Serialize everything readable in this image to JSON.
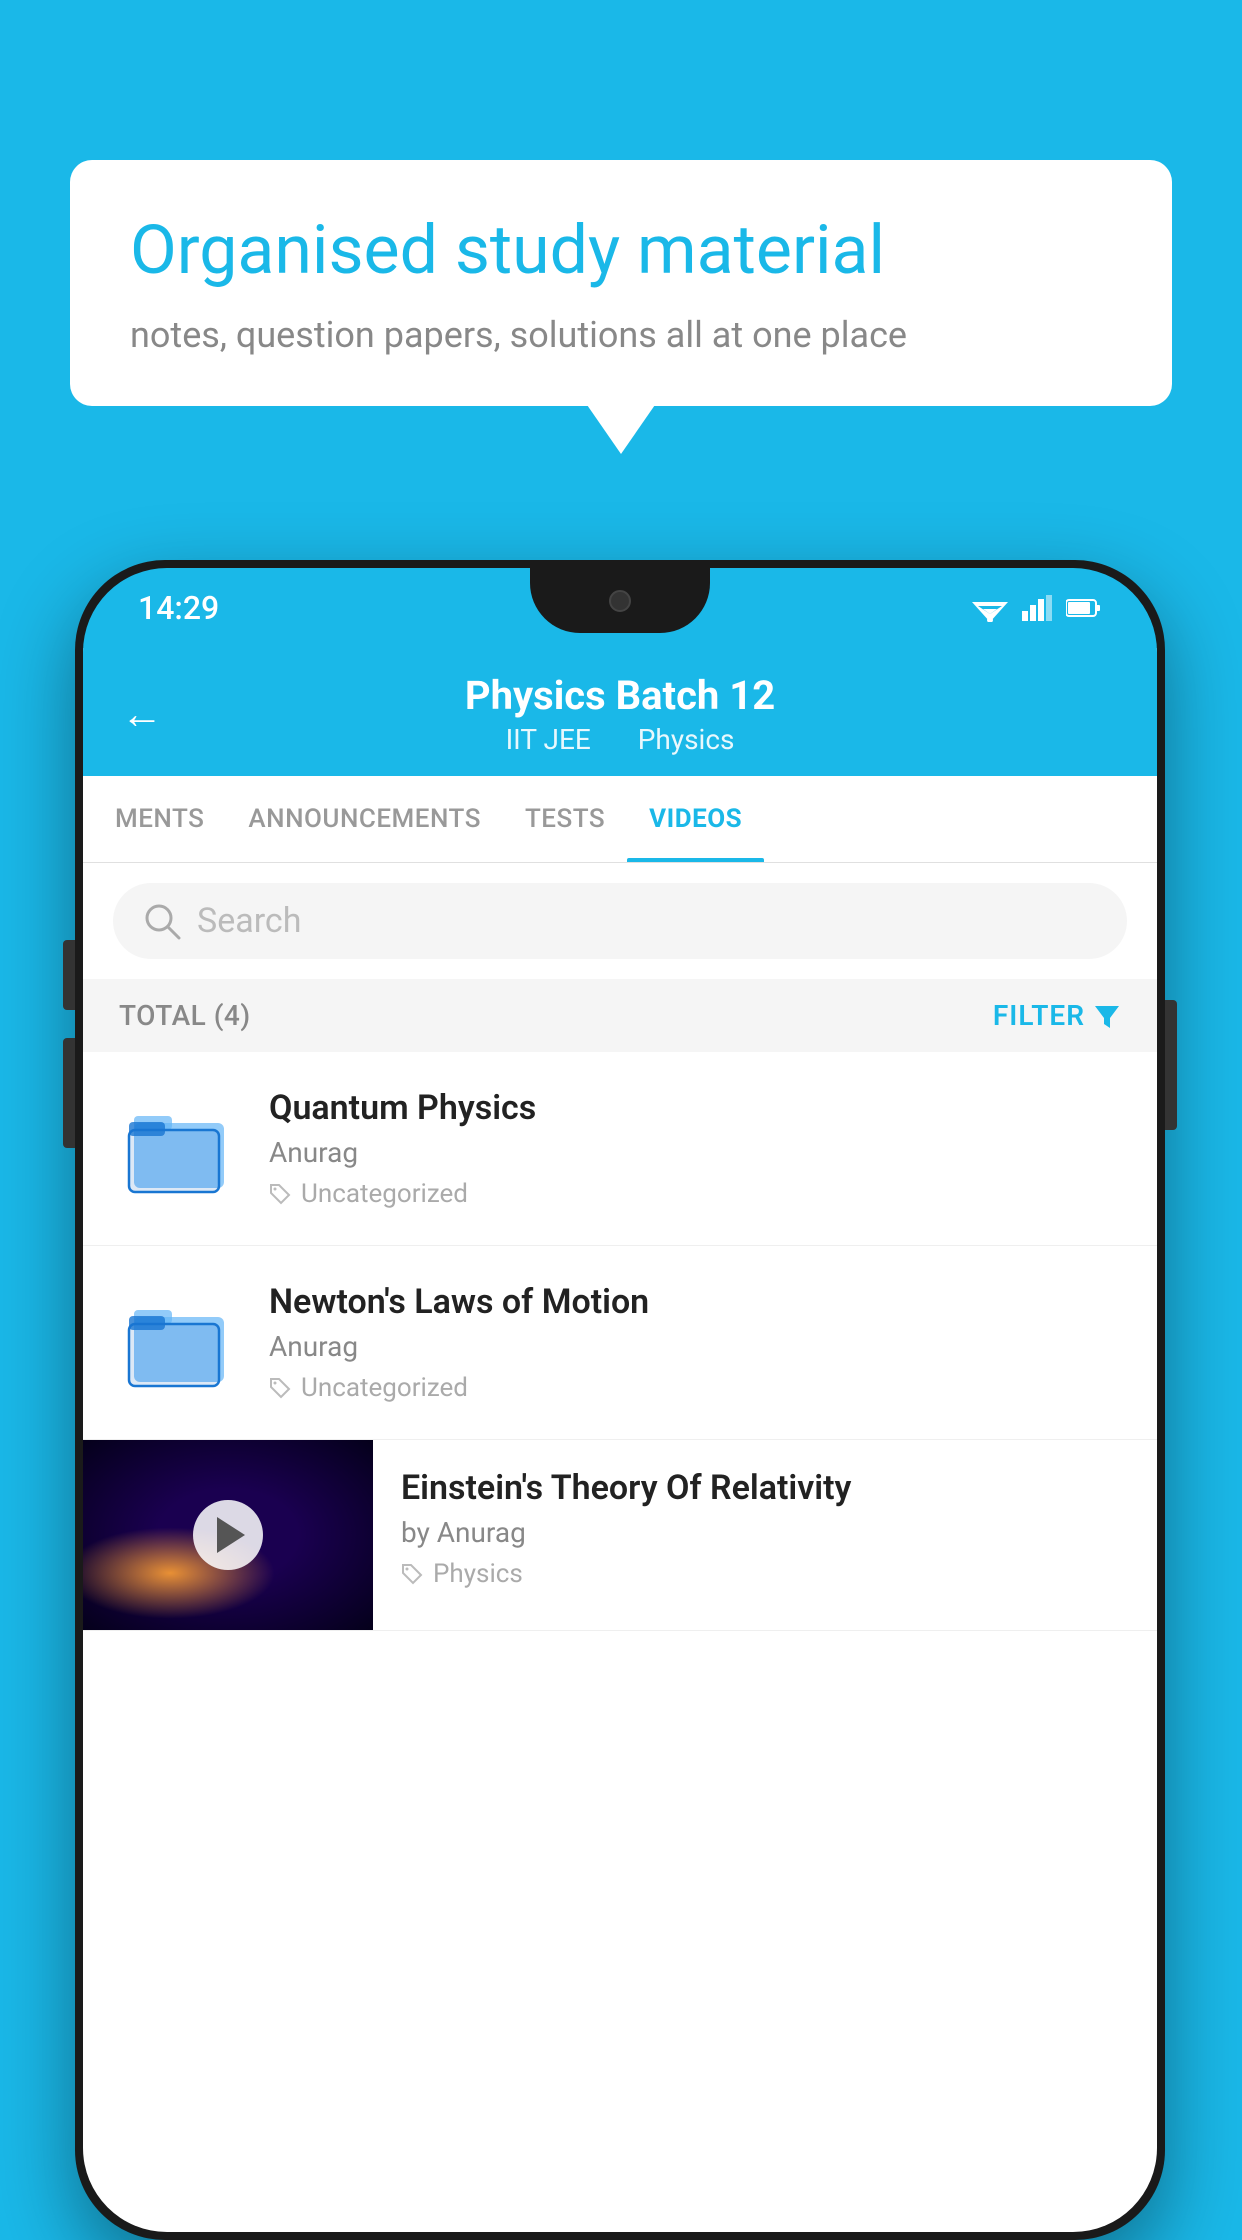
{
  "background": {
    "color": "#1ab8e8"
  },
  "speech_bubble": {
    "title": "Organised study material",
    "subtitle": "notes, question papers, solutions all at one place"
  },
  "status_bar": {
    "time": "14:29",
    "wifi": "▲",
    "signal": "▲",
    "battery": "▮"
  },
  "header": {
    "title": "Physics Batch 12",
    "subtitle1": "IIT JEE",
    "subtitle2": "Physics",
    "back_label": "←"
  },
  "tabs": [
    {
      "label": "MENTS",
      "active": false
    },
    {
      "label": "ANNOUNCEMENTS",
      "active": false
    },
    {
      "label": "TESTS",
      "active": false
    },
    {
      "label": "VIDEOS",
      "active": true
    }
  ],
  "search": {
    "placeholder": "Search"
  },
  "filter_bar": {
    "total": "TOTAL (4)",
    "filter": "FILTER"
  },
  "videos": [
    {
      "id": 1,
      "title": "Quantum Physics",
      "author": "Anurag",
      "tag": "Uncategorized",
      "type": "folder",
      "has_thumb": false
    },
    {
      "id": 2,
      "title": "Newton's Laws of Motion",
      "author": "Anurag",
      "tag": "Uncategorized",
      "type": "folder",
      "has_thumb": false
    },
    {
      "id": 3,
      "title": "Einstein's Theory Of Relativity",
      "author": "by Anurag",
      "tag": "Physics",
      "type": "video",
      "has_thumb": true
    }
  ]
}
